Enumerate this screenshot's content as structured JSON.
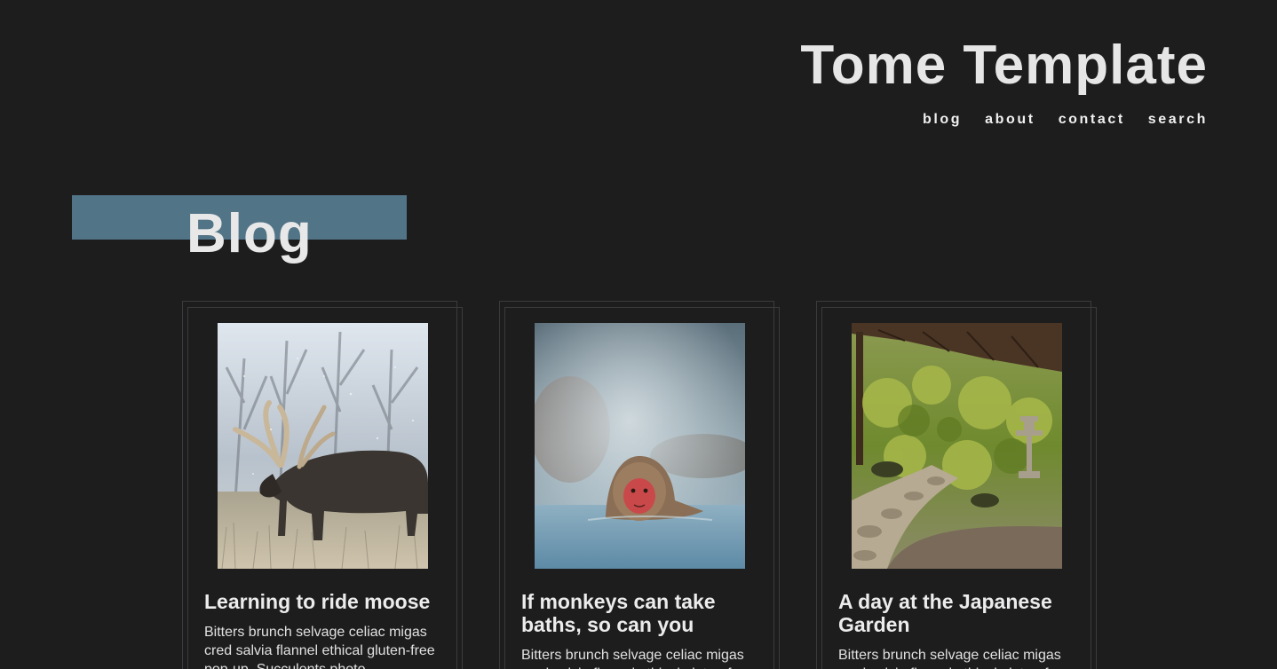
{
  "header": {
    "site_title": "Tome Template",
    "nav": [
      "blog",
      "about",
      "contact",
      "search"
    ]
  },
  "hero": {
    "title": "Blog",
    "band_color": "#527487"
  },
  "posts": [
    {
      "title": "Learning to ride moose",
      "image": "moose-in-snow",
      "excerpt": "Bitters brunch selvage celiac migas cred salvia flannel ethical gluten-free pop-up. Succulents photo"
    },
    {
      "title": "If monkeys can take baths, so can you",
      "image": "snow-monkey-hot-spring",
      "excerpt": "Bitters brunch selvage celiac migas cred salvia flannel ethical gluten-free pop-up."
    },
    {
      "title": "A day at the Japanese Garden",
      "image": "japanese-garden-path",
      "excerpt": "Bitters brunch selvage celiac migas cred salvia flannel ethical gluten-free pop-up."
    }
  ],
  "colors": {
    "background": "#1d1d1e",
    "card_border": "#3b3b3d",
    "text": "#e8e8e8"
  }
}
